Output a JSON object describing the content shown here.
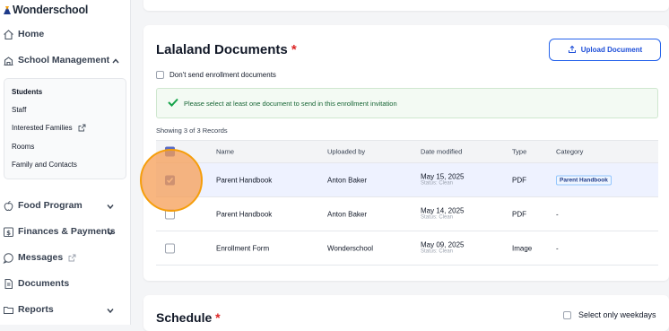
{
  "app": {
    "brand": "Wonderschool"
  },
  "sidebar": {
    "home": "Home",
    "school_management": "School Management",
    "sub_items": [
      "Students",
      "Staff",
      "Interested Families",
      "Rooms",
      "Family and Contacts"
    ],
    "food_program": "Food Program",
    "finances": "Finances & Payments",
    "messages": "Messages",
    "documents": "Documents",
    "reports": "Reports"
  },
  "documents_card": {
    "title": "Lalaland Documents",
    "required_mark": "*",
    "upload_label": "Upload Document",
    "dont_send_label": "Don't send enrollment documents",
    "alert_text": "Please select at least one document to send in this enrollment invitation",
    "records_text": "Showing 3 of 3 Records",
    "columns": [
      "Name",
      "Uploaded by",
      "Date modified",
      "Type",
      "Category"
    ],
    "rows": [
      {
        "name": "Parent Handbook",
        "uploaded_by": "Anton Baker",
        "date": "May 15, 2025",
        "status": "Status: Clean",
        "type": "PDF",
        "category": "Parent Handbook",
        "checked": true
      },
      {
        "name": "Parent Handbook",
        "uploaded_by": "Anton Baker",
        "date": "May 14, 2025",
        "status": "Status: Clean",
        "type": "PDF",
        "category": "-",
        "checked": false
      },
      {
        "name": "Enrollment Form",
        "uploaded_by": "Wonderschool",
        "date": "May 09, 2025",
        "status": "Status: Clean",
        "type": "Image",
        "category": "-",
        "checked": false
      }
    ]
  },
  "schedule_card": {
    "title": "Schedule",
    "required_mark": "*",
    "weekdays_label": "Select only weekdays"
  },
  "colors": {
    "accent": "#2563eb",
    "checkbox": "#5a6bc4",
    "highlight": "#f5a05a",
    "required": "#dc2626"
  }
}
